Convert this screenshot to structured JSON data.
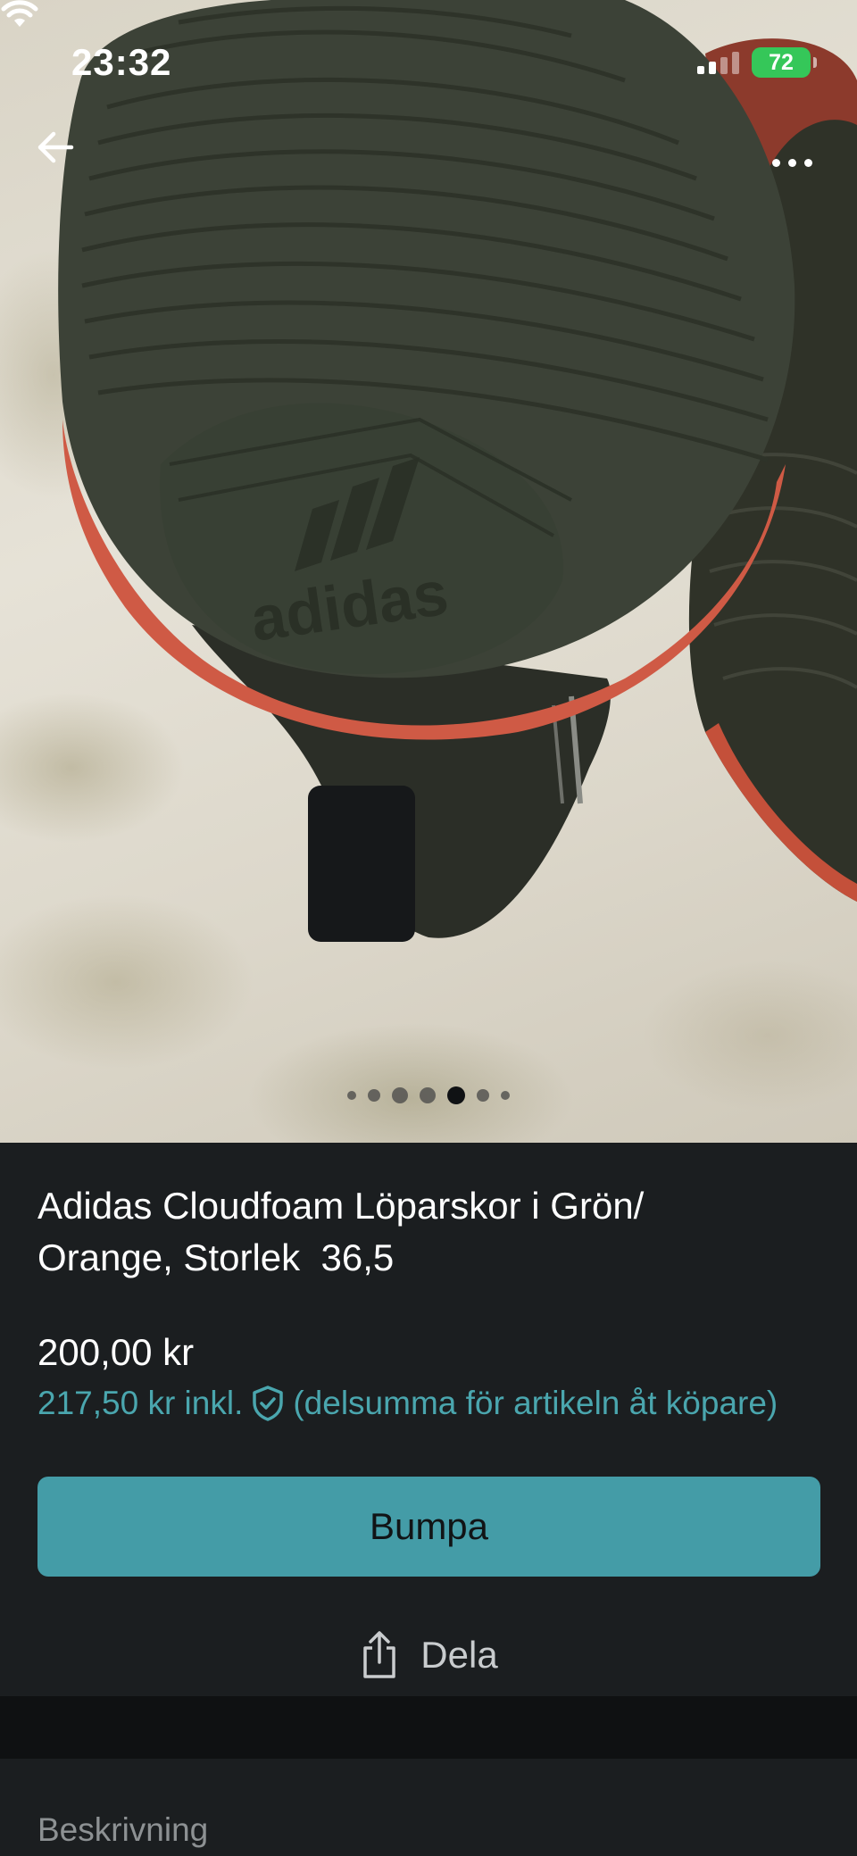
{
  "status_bar": {
    "time": "23:32",
    "battery": "72"
  },
  "hero": {
    "image_description_icon": "sneaker-photo",
    "carousel": {
      "count": 7,
      "active_index": 4
    }
  },
  "listing": {
    "title": "Adidas Cloudfoam Löparskor i Grön/\nOrange, Storlek  36,5",
    "price": "200,00 kr",
    "price_incl": "217,50 kr inkl.",
    "price_incl_note": "(delsumma för artikeln åt köpare)",
    "bump_label": "Bumpa",
    "share_label": "Dela"
  },
  "description": {
    "heading": "Beskrivning"
  },
  "colors": {
    "accent": "#449ca7",
    "price_incl_text": "#4aa6ae",
    "background": "#1b1e20"
  }
}
